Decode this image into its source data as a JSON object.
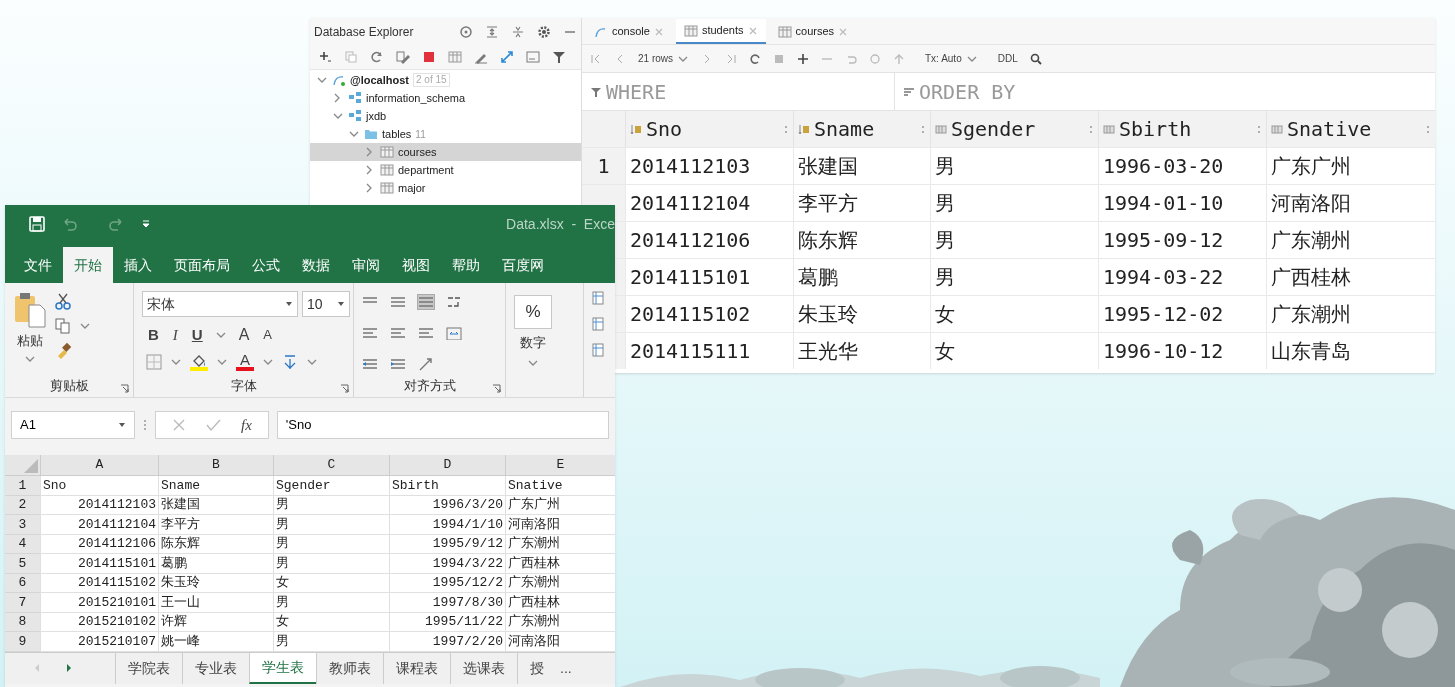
{
  "database_explorer": {
    "title": "Database Explorer",
    "tree": [
      {
        "label": "@localhost",
        "badge": "2 of 15",
        "kind": "host",
        "expanded": true,
        "selected": false,
        "children": [
          {
            "label": "information_schema",
            "kind": "schema",
            "expanded": false,
            "selected": false
          },
          {
            "label": "jxdb",
            "kind": "schema",
            "expanded": true,
            "selected": false,
            "children": [
              {
                "label": "tables",
                "count": "11",
                "kind": "folder",
                "expanded": true,
                "selected": false,
                "children": [
                  {
                    "label": "courses",
                    "kind": "table",
                    "expanded": false,
                    "selected": true
                  },
                  {
                    "label": "department",
                    "kind": "table",
                    "expanded": false,
                    "selected": false
                  },
                  {
                    "label": "major",
                    "kind": "table",
                    "expanded": false,
                    "selected": false
                  }
                ]
              }
            ]
          }
        ]
      }
    ]
  },
  "editor": {
    "tabs": [
      {
        "label": "console",
        "kind": "console",
        "selected": false
      },
      {
        "label": "students",
        "kind": "table",
        "selected": true
      },
      {
        "label": "courses",
        "kind": "table",
        "selected": false
      }
    ],
    "rows_label": "21 rows",
    "tx_label": "Tx: Auto",
    "ddl_label": "DDL",
    "where": "WHERE",
    "order_by": "ORDER BY",
    "columns": [
      {
        "name": "Sno",
        "kind": "key"
      },
      {
        "name": "Sname",
        "kind": "key"
      },
      {
        "name": "Sgender",
        "kind": "plain"
      },
      {
        "name": "Sbirth",
        "kind": "plain"
      },
      {
        "name": "Snative",
        "kind": "plain"
      }
    ],
    "rows": [
      {
        "number": "1",
        "cells": [
          "2014112103",
          "张建国",
          "男",
          "1996-03-20",
          "广东广州"
        ]
      },
      {
        "cells": [
          "2014112104",
          "李平方",
          "男",
          "1994-01-10",
          "河南洛阳"
        ]
      },
      {
        "cells": [
          "2014112106",
          "陈东辉",
          "男",
          "1995-09-12",
          "广东潮州"
        ]
      },
      {
        "cells": [
          "2014115101",
          "葛鹏",
          "男",
          "1994-03-22",
          "广西桂林"
        ]
      },
      {
        "cells": [
          "2014115102",
          "朱玉玲",
          "女",
          "1995-12-02",
          "广东潮州"
        ]
      },
      {
        "cells": [
          "2014115111",
          "王光华",
          "女",
          "1996-10-12",
          "山东青岛"
        ]
      }
    ]
  },
  "excel": {
    "title": "Data.xlsx  -  Exce",
    "ribbon_tabs": [
      {
        "label": "文件",
        "selected": false
      },
      {
        "label": "开始",
        "selected": true
      },
      {
        "label": "插入",
        "selected": false
      },
      {
        "label": "页面布局",
        "selected": false
      },
      {
        "label": "公式",
        "selected": false
      },
      {
        "label": "数据",
        "selected": false
      },
      {
        "label": "审阅",
        "selected": false
      },
      {
        "label": "视图",
        "selected": false
      },
      {
        "label": "帮助",
        "selected": false
      },
      {
        "label": "百度网",
        "selected": false
      }
    ],
    "paste_label": "粘贴",
    "font_name": "宋体",
    "font_size": "10",
    "font_buttons": [
      {
        "label": "B",
        "kind": "bold"
      },
      {
        "label": "I",
        "kind": "italic"
      },
      {
        "label": "U",
        "kind": "underline"
      },
      {
        "label": "A",
        "kind": "grow"
      },
      {
        "label": "A",
        "kind": "shrink"
      }
    ],
    "color_buttons": [
      {
        "kind": "fill",
        "color": "#ffee00"
      },
      {
        "kind": "font",
        "label": "A",
        "color": "#e8101a"
      }
    ],
    "number_symbol": "%",
    "number_label": "数字",
    "groups": [
      "剪贴板",
      "字体",
      "对齐方式"
    ],
    "name_box": "A1",
    "fx": "fx",
    "formula": "'Sno",
    "columns": [
      "A",
      "B",
      "C",
      "D",
      "E"
    ],
    "rows": [
      {
        "number": "1",
        "cells": [
          "Sno",
          "Sname",
          "Sgender",
          "Sbirth",
          "Snative"
        ]
      },
      {
        "number": "2",
        "cells": [
          "2014112103",
          "张建国",
          "男",
          "1996/3/20",
          "广东广州"
        ]
      },
      {
        "number": "3",
        "cells": [
          "2014112104",
          "李平方",
          "男",
          "1994/1/10",
          "河南洛阳"
        ]
      },
      {
        "number": "4",
        "cells": [
          "2014112106",
          "陈东辉",
          "男",
          "1995/9/12",
          "广东潮州"
        ]
      },
      {
        "number": "5",
        "cells": [
          "2014115101",
          "葛鹏",
          "男",
          "1994/3/22",
          "广西桂林"
        ]
      },
      {
        "number": "6",
        "cells": [
          "2014115102",
          "朱玉玲",
          "女",
          "1995/12/2",
          "广东潮州"
        ]
      },
      {
        "number": "7",
        "cells": [
          "2015210101",
          "王一山",
          "男",
          "1997/8/30",
          "广西桂林"
        ]
      },
      {
        "number": "8",
        "cells": [
          "2015210102",
          "许辉",
          "女",
          "1995/11/22",
          "广东潮州"
        ]
      },
      {
        "number": "9",
        "cells": [
          "2015210107",
          "姚一峰",
          "男",
          "1997/2/20",
          "河南洛阳"
        ]
      }
    ],
    "sheets": [
      {
        "label": "学院表",
        "selected": false
      },
      {
        "label": "专业表",
        "selected": false
      },
      {
        "label": "学生表",
        "selected": true
      },
      {
        "label": "教师表",
        "selected": false
      },
      {
        "label": "课程表",
        "selected": false
      },
      {
        "label": "选课表",
        "selected": false
      },
      {
        "label": "授",
        "selected": false
      }
    ],
    "more_sheets": "..."
  }
}
